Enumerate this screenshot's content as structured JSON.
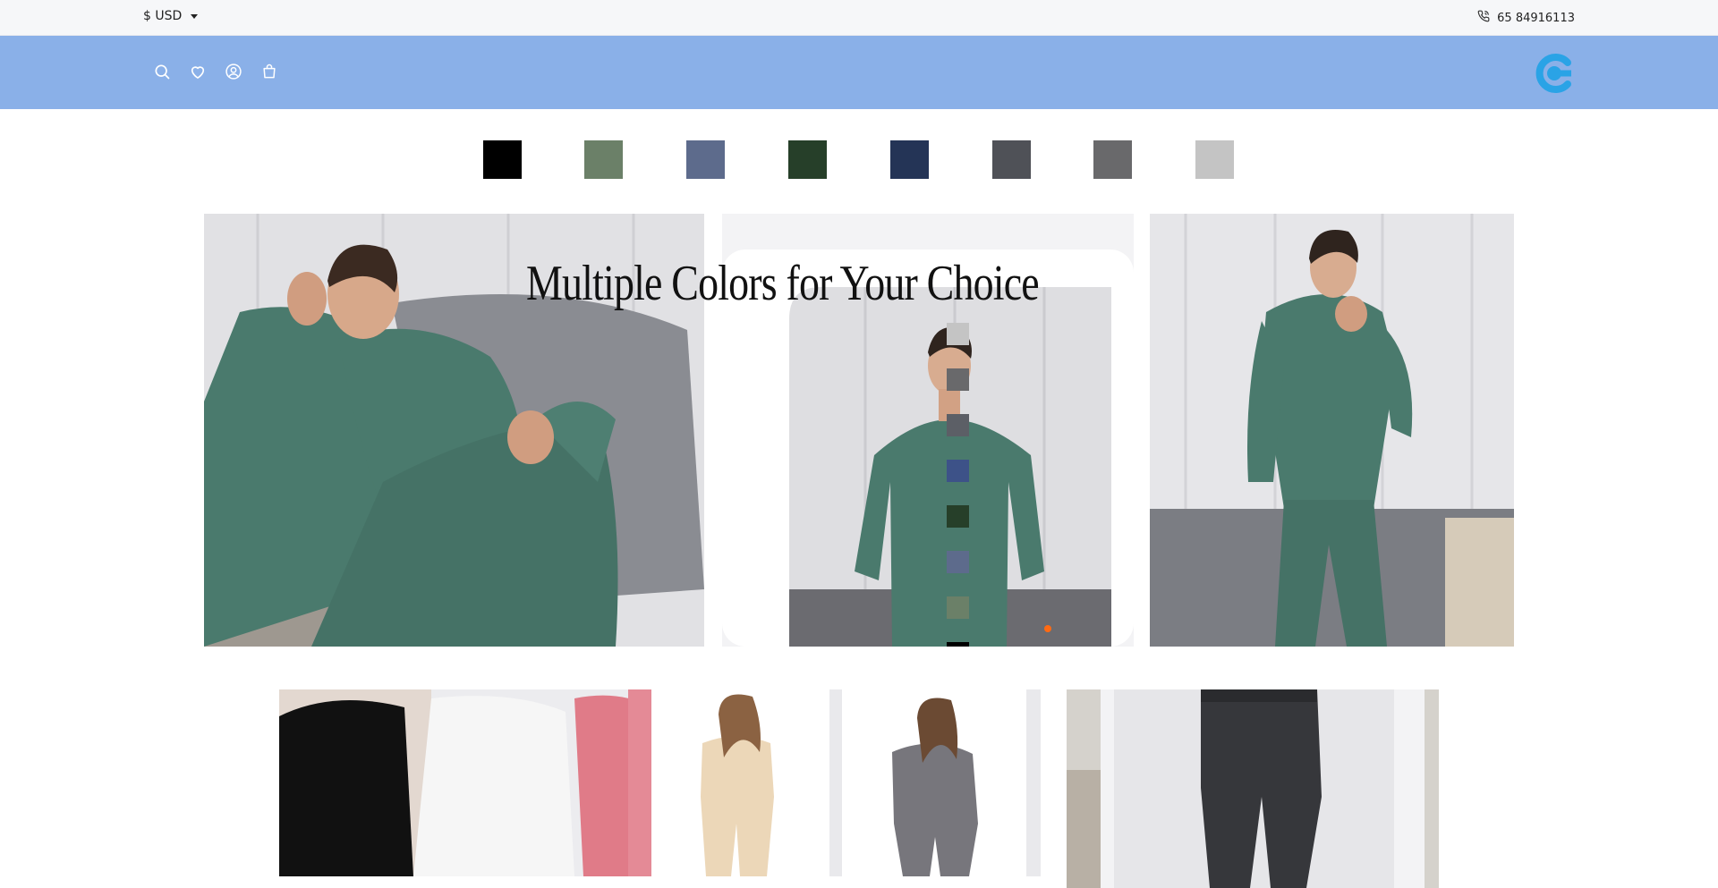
{
  "topbar": {
    "currency_label": "$ USD",
    "phone_icon": "phone-icon",
    "phone_number": "65 84916113"
  },
  "header": {
    "icons": [
      "search-icon",
      "heart-icon",
      "user-icon",
      "bag-icon"
    ],
    "logo_icon": "brand-logo",
    "header_color": "#8ab0e8",
    "logo_color": "#2aa3e6"
  },
  "swatches": [
    "#000000",
    "#6b8068",
    "#5d6b8c",
    "#263f29",
    "#243456",
    "#4f5157",
    "#69696b",
    "#c4c4c4"
  ],
  "banner": {
    "title": "Multiple Colors for Your Choice",
    "mid_swatches": [
      "#c4c4c4",
      "#69696b",
      "#5c5f66",
      "#3d5288",
      "#263f29",
      "#5d6b8c",
      "#6b8068",
      "#000000"
    ],
    "garment_color": "#4a7a6d",
    "active_indicator_color": "#ff6a13"
  },
  "products": [
    {
      "name": "black, white and pink long sleeve tops"
    },
    {
      "name": "cream thermal set"
    },
    {
      "name": "grey thermal set"
    },
    {
      "name": "charcoal thermal leggings"
    }
  ]
}
